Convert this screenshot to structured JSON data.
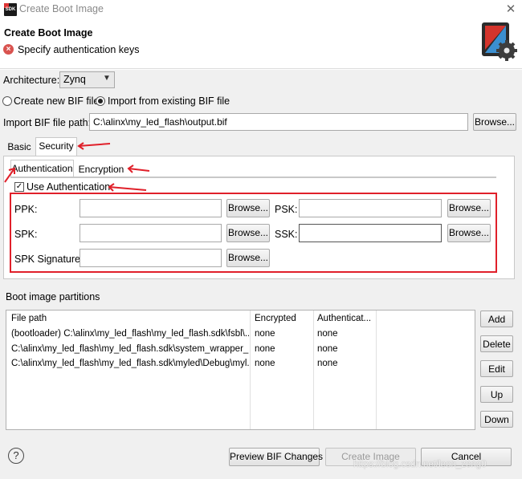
{
  "window": {
    "title": "Create Boot Image",
    "icon_text": "SDK",
    "close_glyph": "✕"
  },
  "header": {
    "title": "Create Boot Image",
    "message": "Specify authentication keys",
    "error_glyph": "×"
  },
  "architecture": {
    "label": "Architecture:",
    "value": "Zynq"
  },
  "bif_mode": {
    "create_label": "Create new BIF file",
    "import_label": "Import from existing BIF file",
    "selected": "import"
  },
  "import_path": {
    "label": "Import BIF file path:",
    "value": "C:\\alinx\\my_led_flash\\output.bif",
    "browse": "Browse..."
  },
  "tabs": [
    {
      "label": "Basic"
    },
    {
      "label": "Security"
    }
  ],
  "subtabs": [
    {
      "label": "Authentication"
    },
    {
      "label": "Encryption"
    }
  ],
  "auth": {
    "use_label": "Use Authentication",
    "checked": true,
    "ppk_label": "PPK:",
    "psk_label": "PSK:",
    "spk_label": "SPK:",
    "ssk_label": "SSK:",
    "spk_sig_label": "SPK Signature:",
    "browse": "Browse...",
    "ppk_value": "",
    "psk_value": "",
    "spk_value": "",
    "ssk_value": "",
    "spk_sig_value": ""
  },
  "partitions": {
    "label": "Boot image partitions",
    "columns": [
      "File path",
      "Encrypted",
      "Authenticat..."
    ],
    "rows": [
      [
        "(bootloader) C:\\alinx\\my_led_flash\\my_led_flash.sdk\\fsbl\\...",
        "none",
        "none"
      ],
      [
        "C:\\alinx\\my_led_flash\\my_led_flash.sdk\\system_wrapper_h...",
        "none",
        "none"
      ],
      [
        "C:\\alinx\\my_led_flash\\my_led_flash.sdk\\myled\\Debug\\myl...",
        "none",
        "none"
      ]
    ],
    "buttons": {
      "add": "Add",
      "delete": "Delete",
      "edit": "Edit",
      "up": "Up",
      "down": "Down"
    }
  },
  "footer": {
    "help_glyph": "?",
    "preview": "Preview BIF Changes",
    "create": "Create Image",
    "cancel": "Cancel",
    "watermark": "https://blog.csdn.net/leon_zeng0"
  },
  "colors": {
    "highlight": "#e0202a",
    "error": "#d9534f"
  }
}
